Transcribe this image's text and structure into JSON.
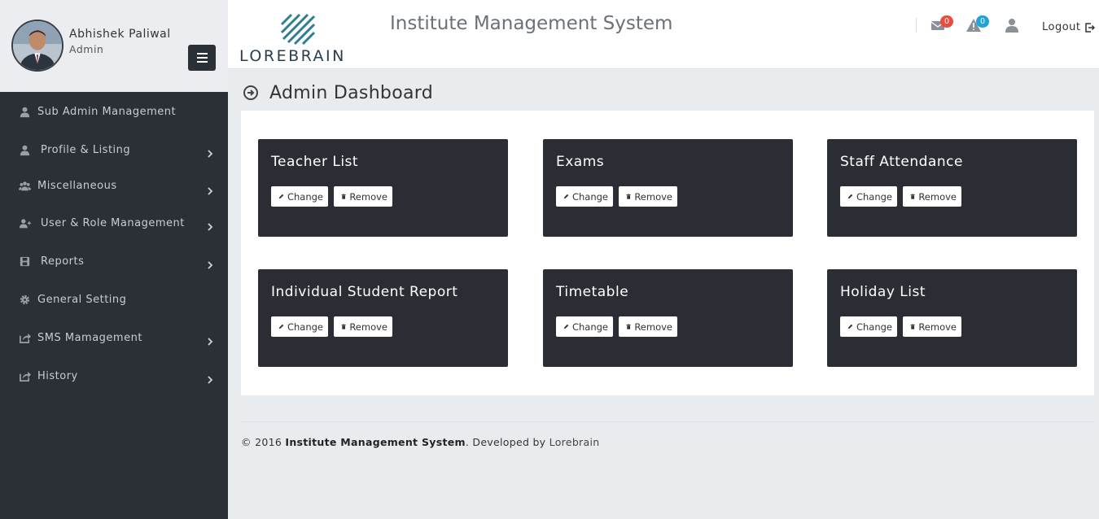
{
  "profile": {
    "name": "Abhishek Paliwal",
    "role": "Admin"
  },
  "sidebar": {
    "items": [
      {
        "label": "Sub Admin Management",
        "icon": "user-icon",
        "has_children": false
      },
      {
        "label": "Profile & Listing",
        "icon": "user-icon",
        "has_children": true
      },
      {
        "label": "Miscellaneous",
        "icon": "users-icon",
        "has_children": true
      },
      {
        "label": "User & Role Management",
        "icon": "user-plus-icon",
        "has_children": true
      },
      {
        "label": "Reports",
        "icon": "save-icon",
        "has_children": true
      },
      {
        "label": "General Setting",
        "icon": "gear-icon",
        "has_children": false
      },
      {
        "label": "SMS Mamagement",
        "icon": "share-icon",
        "has_children": true
      },
      {
        "label": "History",
        "icon": "share-icon",
        "has_children": true
      }
    ]
  },
  "header": {
    "logo_text": "LOREBRAIN",
    "title": "Institute Management System",
    "messages_count": "0",
    "alerts_count": "0",
    "logout_label": "Logout"
  },
  "main": {
    "page_title": "Admin Dashboard",
    "cards": [
      {
        "title": "Teacher List",
        "change_label": "Change",
        "remove_label": "Remove"
      },
      {
        "title": "Exams",
        "change_label": "Change",
        "remove_label": "Remove"
      },
      {
        "title": "Staff Attendance",
        "change_label": "Change",
        "remove_label": "Remove"
      },
      {
        "title": "Individual Student Report",
        "change_label": "Change",
        "remove_label": "Remove"
      },
      {
        "title": "Timetable",
        "change_label": "Change",
        "remove_label": "Remove"
      },
      {
        "title": "Holiday List",
        "change_label": "Change",
        "remove_label": "Remove"
      }
    ]
  },
  "footer": {
    "prefix": "© 2016",
    "app_name": "Institute Management System",
    "developed_by": ". Developed by",
    "developer": "Lorebrain"
  },
  "colors": {
    "sidebar_bg": "#2b2f36",
    "card_bg": "#2b2d34",
    "badge_red": "#e74c3c",
    "badge_blue": "#1ea4d6",
    "logo_teal": "#2e7f8f"
  }
}
